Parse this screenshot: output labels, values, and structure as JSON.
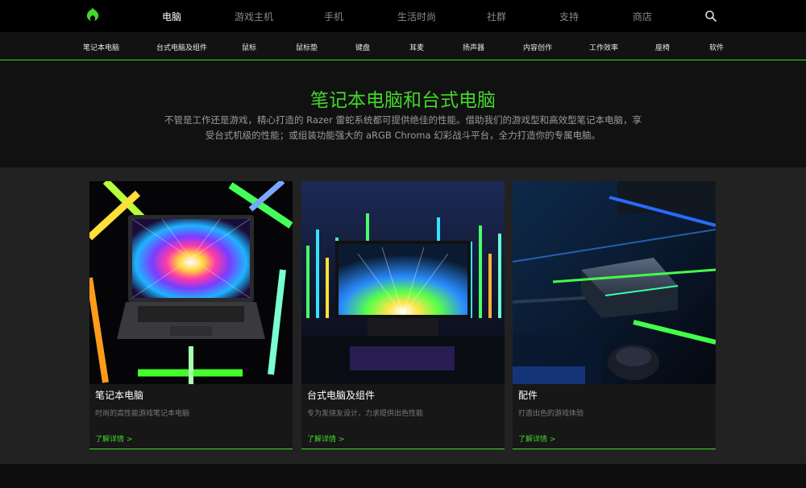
{
  "topnav": {
    "items": [
      "电脑",
      "游戏主机",
      "手机",
      "生活时尚",
      "社群",
      "支持",
      "商店"
    ],
    "active_index": 0
  },
  "subnav": {
    "items": [
      "笔记本电脑",
      "台式电脑及组件",
      "鼠标",
      "鼠标垫",
      "键盘",
      "耳麦",
      "扬声器",
      "内容创作",
      "工作效率",
      "座椅",
      "软件"
    ]
  },
  "hero": {
    "title": "笔记本电脑和台式电脑",
    "desc_line1": "不管是工作还是游戏，精心打造的 Razer 雷蛇系统都可提供绝佳的性能。借助我们的游戏型和高效型笔记本电脑，享",
    "desc_line2": "受台式机级的性能；或组装功能强大的 aRGB Chroma 幻彩战斗平台，全力打造你的专属电脑。"
  },
  "cards": [
    {
      "title": "笔记本电脑",
      "subtitle": "时尚的高性能游戏笔记本电脑",
      "link": "了解详情 >"
    },
    {
      "title": "台式电脑及组件",
      "subtitle": "专为发烧友设计，力求提供出色性能",
      "link": "了解详情 >"
    },
    {
      "title": "配件",
      "subtitle": "打造出色的游戏体验",
      "link": "了解详情 >"
    }
  ],
  "colors": {
    "accent": "#44d62c",
    "background": "#111111",
    "card": "#171717"
  },
  "icons": {
    "logo": "razer-logo",
    "search": "search-icon"
  }
}
